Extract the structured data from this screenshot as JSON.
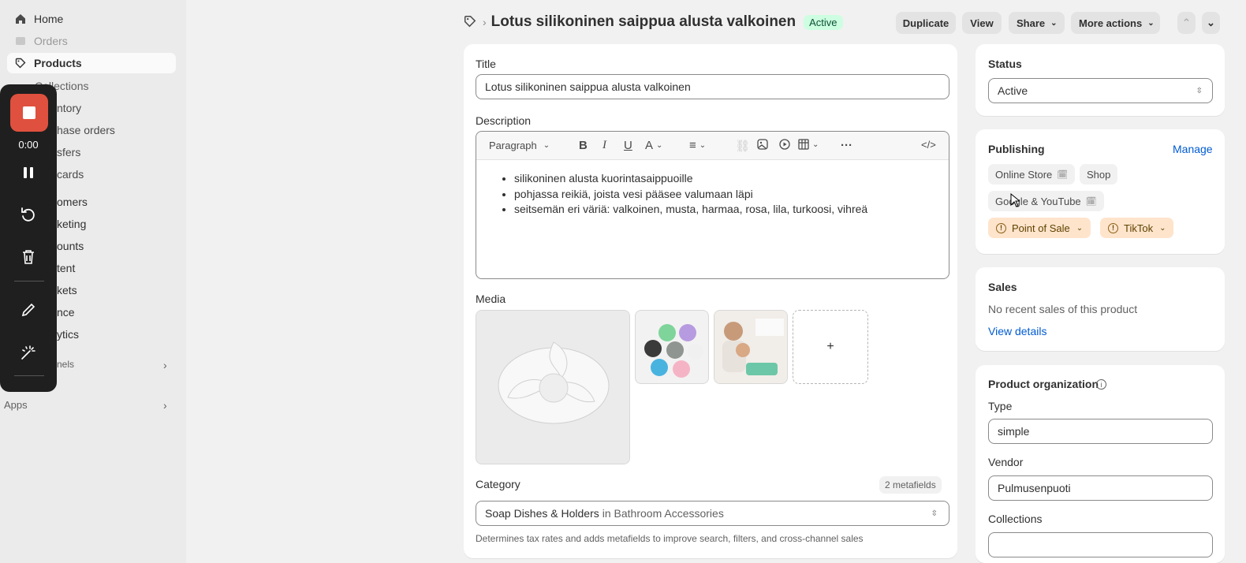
{
  "sidebar": {
    "home": "Home",
    "orders": "Orders",
    "products": "Products",
    "collections": "Collections",
    "inventory": "ntory",
    "purchase_orders": "hase orders",
    "transfers": "sfers",
    "gift_cards": "cards",
    "customers": "omers",
    "marketing": "keting",
    "discounts": "ounts",
    "content": "tent",
    "markets": "kets",
    "finance": "nce",
    "analytics": "ytics",
    "channels": "nels",
    "apps": "Apps"
  },
  "recorder": {
    "time": "0:00"
  },
  "header": {
    "title": "Lotus silikoninen saippua alusta valkoinen",
    "status_badge": "Active",
    "duplicate": "Duplicate",
    "view": "View",
    "share": "Share",
    "more_actions": "More actions"
  },
  "main": {
    "title_label": "Title",
    "title_value": "Lotus silikoninen saippua alusta valkoinen",
    "description_label": "Description",
    "toolbar": {
      "paragraph": "Paragraph"
    },
    "description_items": [
      "silikoninen alusta kuorintasaippuoille",
      "pohjassa reikiä, joista vesi pääsee valumaan läpi",
      "seitsemän eri väriä: valkoinen, musta, harmaa, rosa, lila, turkoosi, vihreä"
    ],
    "media_label": "Media",
    "add_media": "+",
    "category_label": "Category",
    "metafields_badge": "2 metafields",
    "category_value": "Soap Dishes & Holders",
    "category_in": "in Bathroom Accessories",
    "category_help": "Determines tax rates and adds metafields to improve search, filters, and cross-channel sales"
  },
  "status_card": {
    "label": "Status",
    "value": "Active"
  },
  "publishing": {
    "label": "Publishing",
    "manage": "Manage",
    "channels": [
      "Online Store",
      "Shop",
      "Google & YouTube"
    ],
    "warnings": [
      "Point of Sale",
      "TikTok"
    ]
  },
  "sales": {
    "label": "Sales",
    "text": "No recent sales of this product",
    "link": "View details"
  },
  "organization": {
    "label": "Product organization",
    "type_label": "Type",
    "type_value": "simple",
    "vendor_label": "Vendor",
    "vendor_value": "Pulmusenpuoti",
    "collections_label": "Collections",
    "collections_value": ""
  },
  "colors": {
    "accent": "#005bd3",
    "active_badge_bg": "#cdfee1",
    "recorder_stop": "#e0503e",
    "warning_chip": "#ffe4cc"
  }
}
